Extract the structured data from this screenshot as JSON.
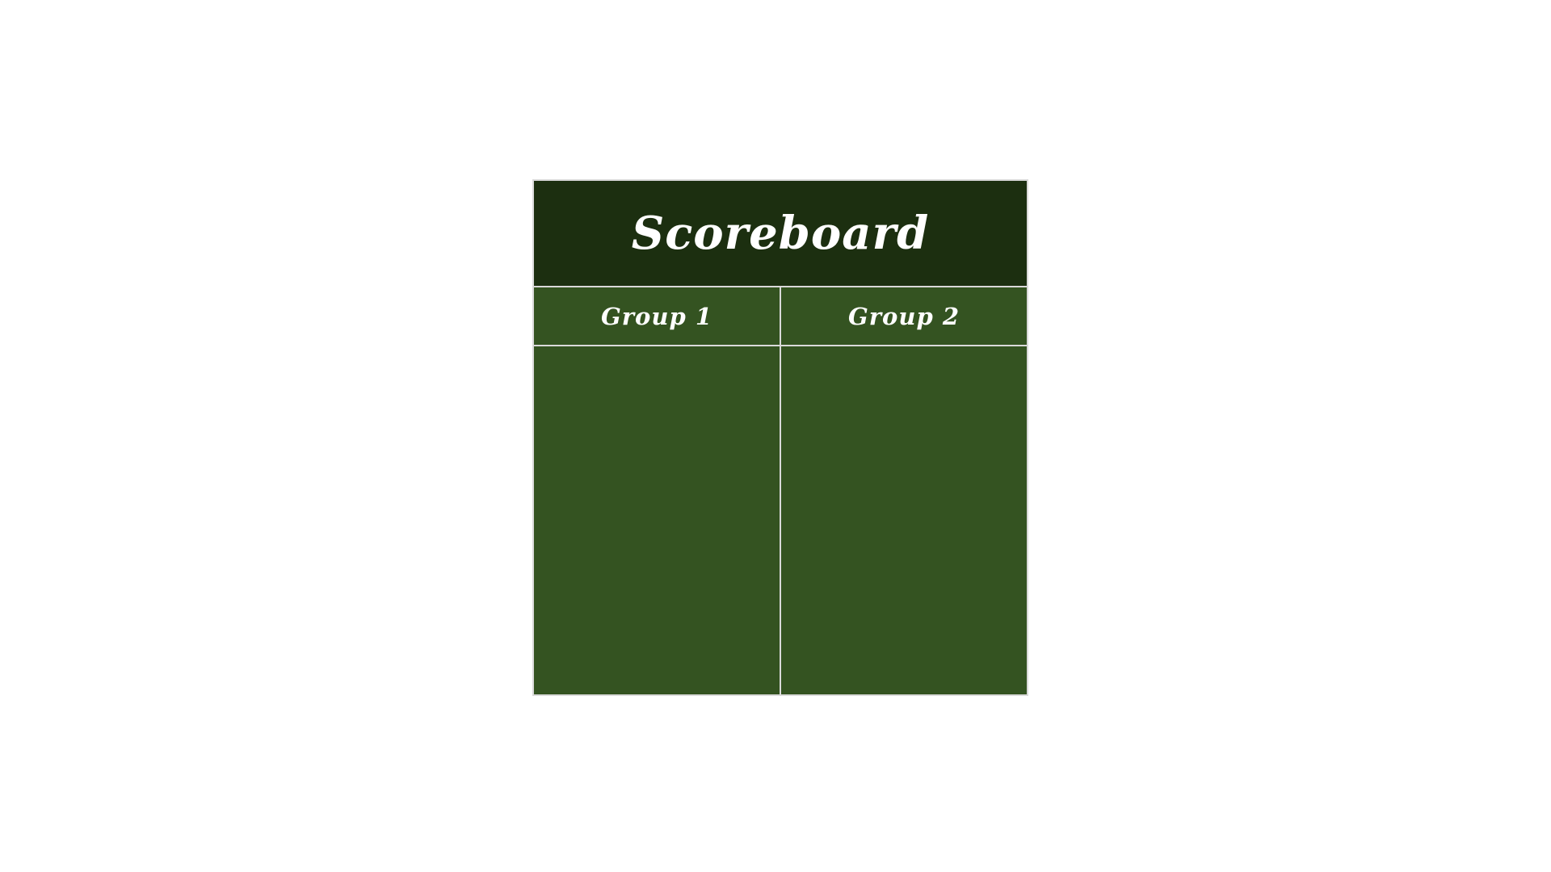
{
  "scoreboard": {
    "title": "Scoreboard",
    "groups": [
      {
        "label": "Group 1"
      },
      {
        "label": "Group 2"
      }
    ]
  },
  "colors": {
    "header_background": "#1c2f10",
    "board_background": "#345321",
    "grid_lines": "#d9d9d9",
    "text": "#ffffff",
    "page_background": "#ffffff"
  }
}
